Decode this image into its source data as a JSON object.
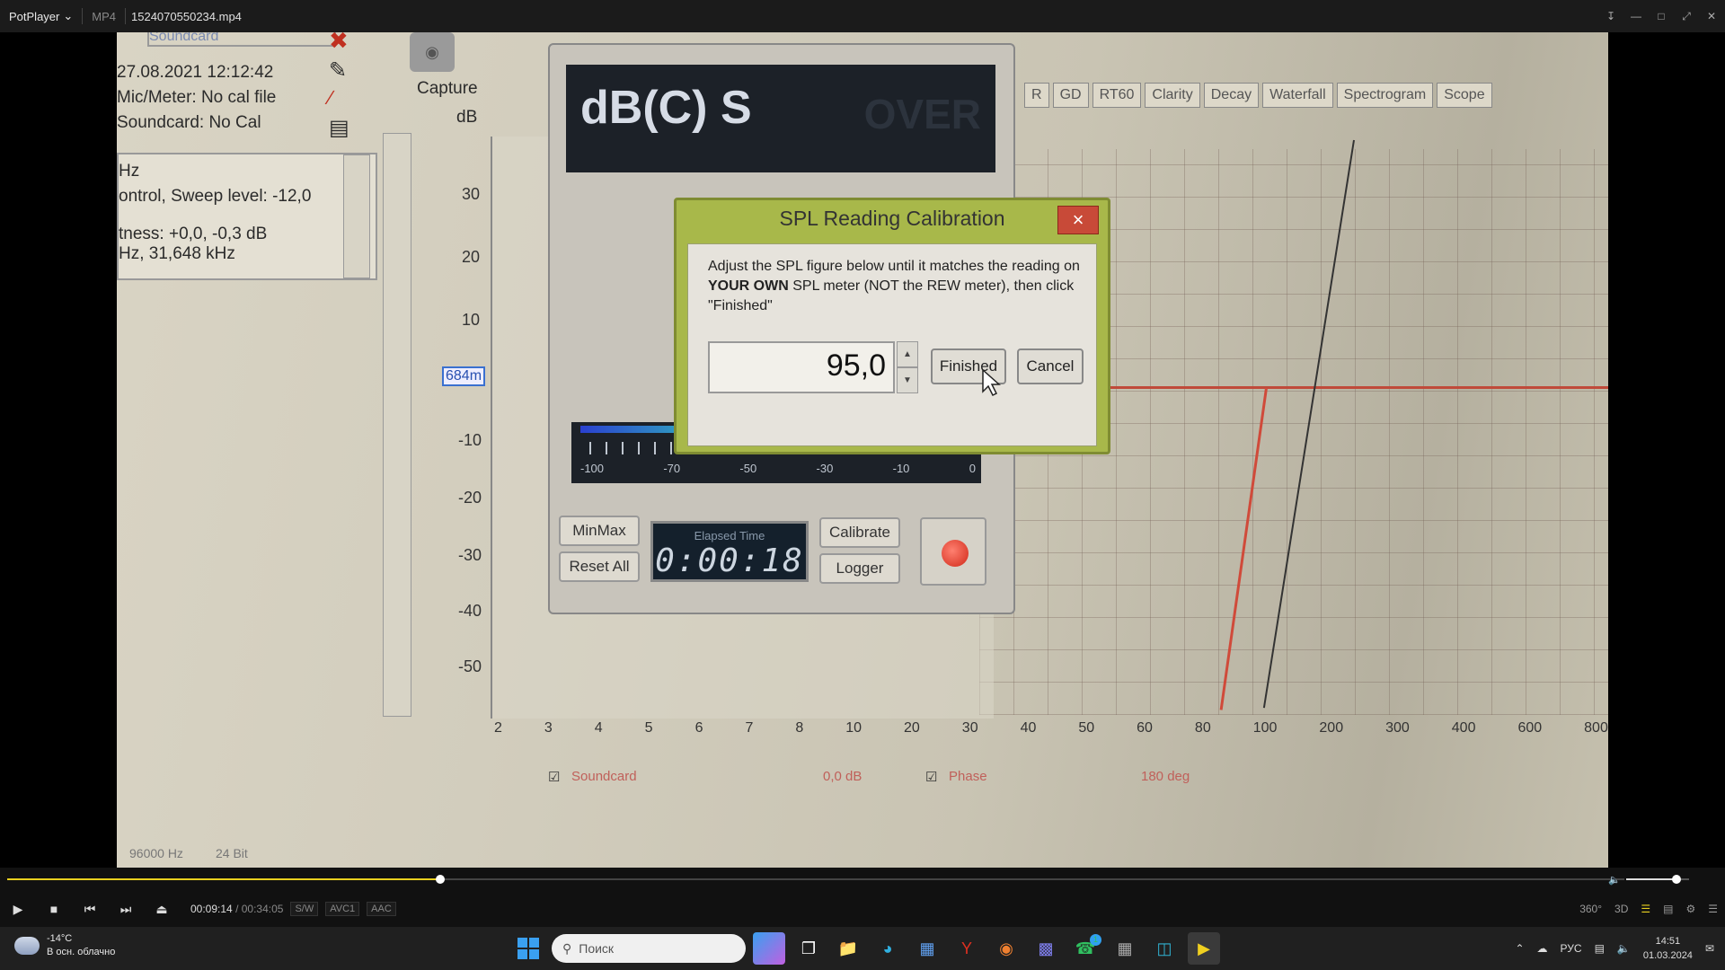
{
  "titlebar": {
    "app_name": "PotPlayer",
    "format": "MP4",
    "file_name": "1524070550234.mp4"
  },
  "video": {
    "left_panel": {
      "soundcard_label": "Soundcard",
      "date": "27.08.2021 12:12:42",
      "mic_meter": "Mic/Meter: No cal file",
      "soundcard_cal": "Soundcard: No Cal",
      "info_1": "Hz",
      "info_2": "ontrol, Sweep level: -12,0",
      "info_3": "tness: +0,0, -0,3 dB",
      "info_4": "Hz,  31,648 kHz"
    },
    "capture_label": "Capture",
    "db_label": "dB",
    "y_axis": [
      "30",
      "20",
      "10",
      "684m",
      "-10",
      "-20",
      "-30",
      "-40",
      "-50"
    ],
    "x_axis": [
      "2",
      "3",
      "4",
      "5",
      "6",
      "7",
      "8",
      "10",
      "20",
      "30",
      "40",
      "50",
      "60",
      "80",
      "100",
      "200",
      "300",
      "400",
      "600",
      "800"
    ],
    "tabs": [
      "R",
      "GD",
      "RT60",
      "Clarity",
      "Decay",
      "Waterfall",
      "Spectrogram",
      "Scope"
    ],
    "meter": {
      "reading_label": "dB(C) S",
      "over_label": "OVER",
      "scale": [
        "-100",
        "-70",
        "-50",
        "-30",
        "-10",
        "0"
      ],
      "minmax": "MinMax",
      "reset_all": "Reset All",
      "elapsed_label": "Elapsed Time",
      "elapsed_value": "0:00:18",
      "calibrate": "Calibrate",
      "logger": "Logger"
    },
    "dialog": {
      "title": "SPL Reading Calibration",
      "close": "×",
      "msg_1": "Adjust the SPL figure below until it matches the reading on ",
      "msg_bold": "YOUR OWN",
      "msg_2": " SPL meter (NOT the REW meter), then click \"Finished\"",
      "value": "95,0",
      "finished": "Finished",
      "cancel": "Cancel"
    },
    "bottom": {
      "soundcard": "Soundcard",
      "db": "0,0 dB",
      "phase": "Phase",
      "deg": "180 deg",
      "sample_rate": "96000 Hz",
      "bits": "24 Bit"
    }
  },
  "player": {
    "progress_fraction": 0.268,
    "volume_fraction": 0.8,
    "current_time": "00:09:14",
    "separator": "/",
    "total_time": "00:34:05",
    "badges": [
      "S/W",
      "AVC1",
      "AAC"
    ],
    "right_buttons": [
      "360°",
      "3D"
    ]
  },
  "taskbar": {
    "temperature": "-14°C",
    "weather_desc": "В осн. облачно",
    "search_placeholder": "Поиск",
    "language": "РУС",
    "time": "14:51",
    "date": "01.03.2024",
    "whatsapp_badge": "1"
  }
}
